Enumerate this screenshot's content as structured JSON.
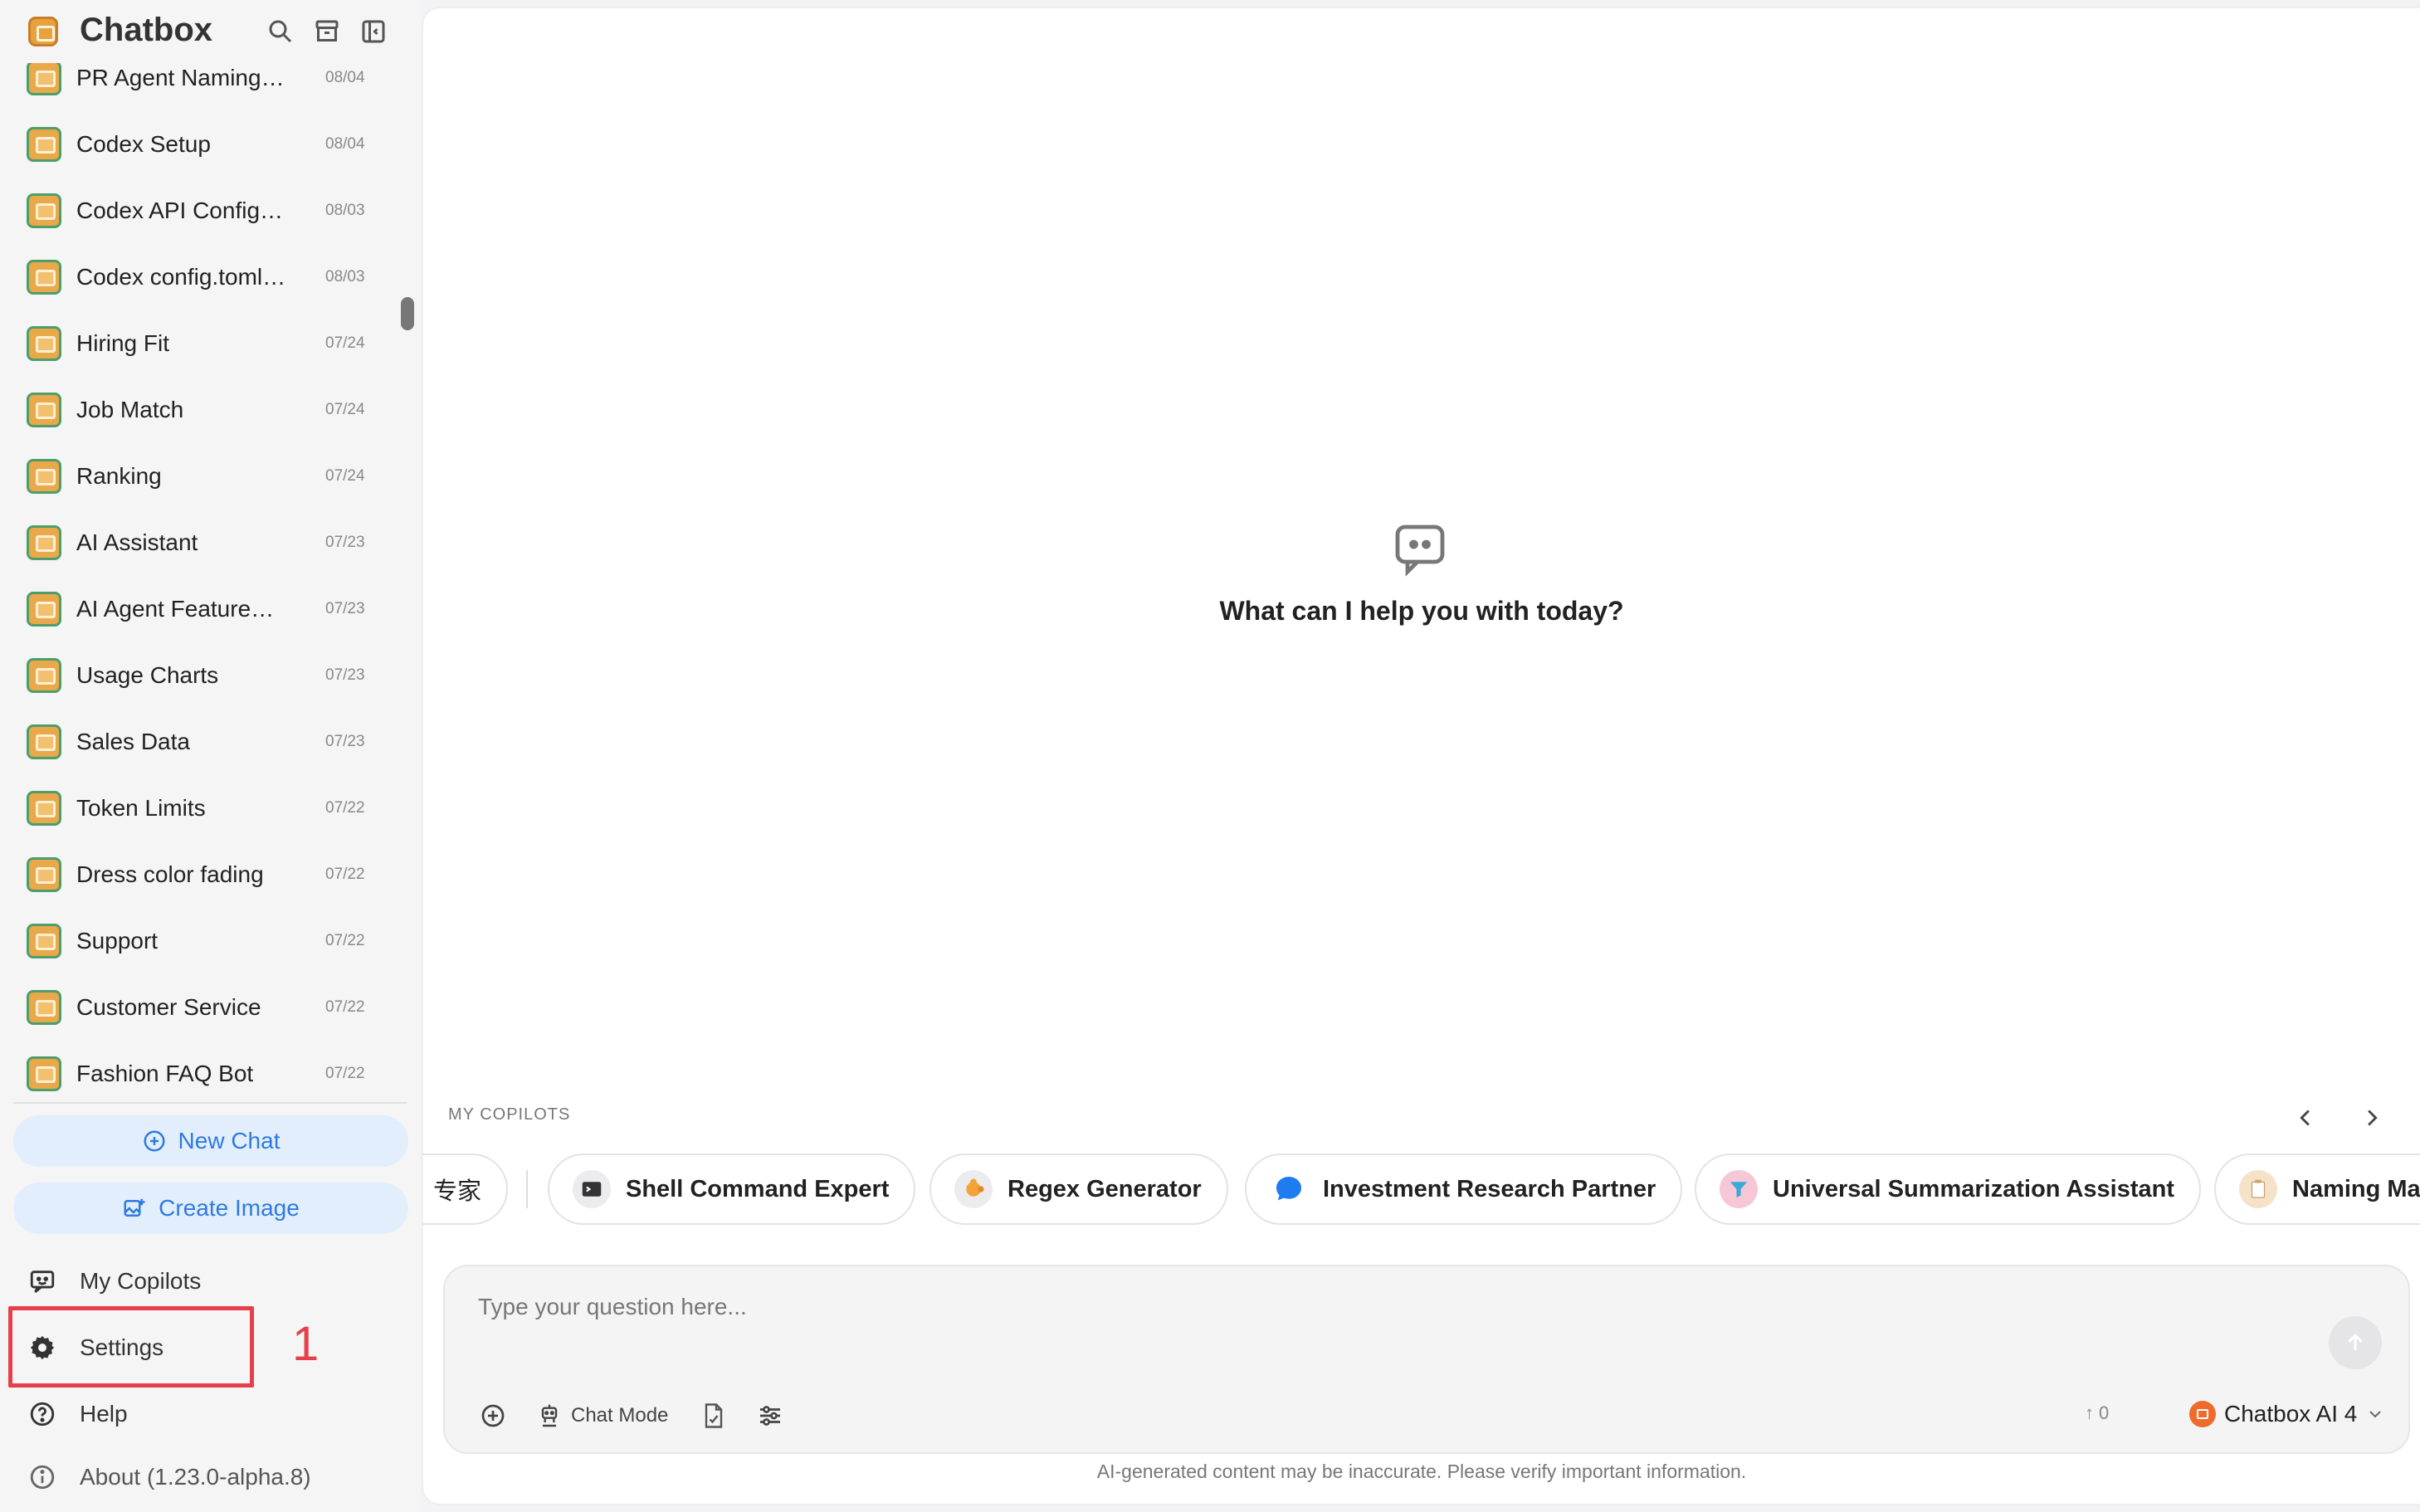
{
  "app": {
    "title": "Chatbox"
  },
  "chats": [
    {
      "title": "PR Agent Naming…",
      "date": "08/04"
    },
    {
      "title": "Codex Setup",
      "date": "08/04"
    },
    {
      "title": "Codex API Config…",
      "date": "08/03"
    },
    {
      "title": "Codex config.toml…",
      "date": "08/03"
    },
    {
      "title": "Hiring Fit",
      "date": "07/24"
    },
    {
      "title": "Job Match",
      "date": "07/24"
    },
    {
      "title": "Ranking",
      "date": "07/24"
    },
    {
      "title": "AI Assistant",
      "date": "07/23"
    },
    {
      "title": "AI Agent Feature…",
      "date": "07/23"
    },
    {
      "title": "Usage Charts",
      "date": "07/23"
    },
    {
      "title": "Sales Data",
      "date": "07/23"
    },
    {
      "title": "Token Limits",
      "date": "07/22"
    },
    {
      "title": "Dress color fading",
      "date": "07/22"
    },
    {
      "title": "Support",
      "date": "07/22"
    },
    {
      "title": "Customer Service",
      "date": "07/22"
    },
    {
      "title": "Fashion FAQ Bot",
      "date": "07/22"
    }
  ],
  "sidebar": {
    "new_chat": "New Chat",
    "create_image": "Create Image",
    "my_copilots": "My Copilots",
    "settings": "Settings",
    "help": "Help",
    "about": "About (1.23.0-alpha.8)"
  },
  "annotation": {
    "step": "1",
    "color": "#e5404a"
  },
  "main": {
    "welcome": "What can I help you with today?",
    "copilots_label": "MY COPILOTS",
    "copilots": [
      {
        "name": "专家",
        "icon": "none"
      },
      {
        "name": "Shell Command Expert",
        "icon": "terminal-icon"
      },
      {
        "name": "Regex Generator",
        "icon": "puzzle-icon"
      },
      {
        "name": "Investment Research Partner",
        "icon": "chat-bubble-icon"
      },
      {
        "name": "Universal Summarization Assistant",
        "icon": "funnel-icon"
      },
      {
        "name": "Naming Ma",
        "icon": "clipboard-icon"
      }
    ],
    "input_placeholder": "Type your question here...",
    "chat_mode": "Chat Mode",
    "token_count": "0",
    "model": "Chatbox AI 4",
    "disclaimer": "AI-generated content may be inaccurate. Please verify important information."
  },
  "colors": {
    "accent": "#2d7be0",
    "accent_bg": "#e3eefc",
    "model_badge": "#f06a2c"
  }
}
